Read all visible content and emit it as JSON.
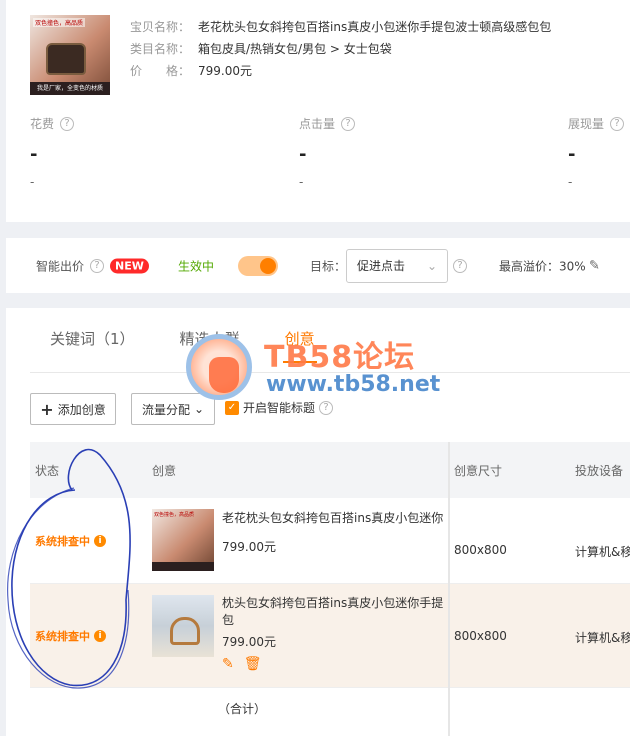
{
  "product": {
    "image_alt": "product-thumbnail",
    "thumb_tag": "双色撞色，高品质",
    "thumb_bar": "我是厂家，全变色的材质",
    "name_label": "宝贝名称：",
    "name": "老花枕头包女斜挎包百搭ins真皮小包迷你手提包波士顿高级感包包",
    "category_label": "类目名称：",
    "category": "箱包皮具/热销女包/男包 > 女士包袋",
    "price_label": "价　　格：",
    "price": "799.00元"
  },
  "metrics": [
    {
      "label": "花费",
      "value": "-",
      "sub": "-"
    },
    {
      "label": "点击量",
      "value": "-",
      "sub": "-"
    },
    {
      "label": "展现量",
      "value": "-",
      "sub": "-"
    }
  ],
  "smart_bid": {
    "label": "智能出价",
    "badge": "NEW",
    "status": "生效中",
    "target_label": "目标：",
    "target_value": "促进点击",
    "max_premium": "最高溢价：30%"
  },
  "tabs": [
    {
      "label": "关键词（1）"
    },
    {
      "label": "精选人群"
    },
    {
      "label": "创意"
    }
  ],
  "toolbar": {
    "add_label": "添加创意",
    "flow_label": "流量分配",
    "smart_title_label": "开启智能标题"
  },
  "table": {
    "headers": [
      "状态",
      "创意",
      "创意尺寸",
      "投放设备"
    ],
    "rows": [
      {
        "status": "系统排查中",
        "title": "老花枕头包女斜挎包百搭ins真皮小包迷你",
        "price": "799.00元",
        "size": "800x800",
        "device": "计算机&移"
      },
      {
        "status": "系统排查中",
        "title": "枕头包女斜挎包百搭ins真皮小包迷你手提包",
        "price": "799.00元",
        "size": "800x800",
        "device": "计算机&移"
      }
    ],
    "total": "（合计）"
  },
  "watermark": {
    "title": "TB58论坛",
    "url": "www.tb58.net"
  },
  "colors": {
    "accent": "#ff7a00",
    "badge": "#ff2a2a",
    "status_green": "#52a800"
  }
}
